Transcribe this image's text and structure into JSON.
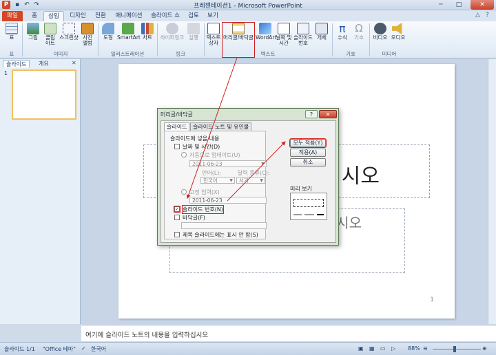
{
  "window": {
    "app_icon": "P",
    "title": "프레젠테이션1 - Microsoft PowerPoint",
    "minimize": "─",
    "maximize": "□",
    "close": "✕"
  },
  "tabs": [
    "파일",
    "홈",
    "삽입",
    "디자인",
    "전환",
    "애니메이션",
    "슬라이드 쇼",
    "검토",
    "보기"
  ],
  "active_tab": "삽입",
  "ribbon": {
    "table": "표",
    "picture": "그림",
    "clipart": "클립 아트",
    "screenshot": "스크린샷",
    "photo_album": "사진 앨범",
    "shapes": "도형",
    "smartart": "SmartArt",
    "chart": "차트",
    "hyperlink": "하이퍼링크",
    "action": "실행",
    "textbox": "텍스트 상자",
    "header_footer": "머리글/바닥글",
    "wordart": "WordArt",
    "date_time": "날짜 및 시간",
    "slide_number": "슬라이드 번호",
    "object": "개체",
    "equation": "수식",
    "symbol": "기호",
    "video": "비디오",
    "audio": "오디오",
    "groups": {
      "table": "표",
      "images": "이미지",
      "illustrations": "일러스트레이션",
      "links": "링크",
      "text": "텍스트",
      "symbols": "기호",
      "media": "미디어"
    }
  },
  "leftpane": {
    "tab_slides": "슬라이드",
    "tab_outline": "개요",
    "close": "✕",
    "slide_number": "1"
  },
  "slide": {
    "title_fragment": "시오",
    "subtitle_fragment": "시오",
    "page_number": "1"
  },
  "notes": {
    "placeholder": "여기에 슬라이드 노트의 내용을 입력하십시오"
  },
  "status": {
    "slide": "슬라이드 1/1",
    "theme": "\"Office 테마\"",
    "language": "한국어",
    "zoom": "88%"
  },
  "dialog": {
    "title": "머리글/바닥글",
    "help": "?",
    "close": "✕",
    "tabs": [
      "슬라이드",
      "슬라이드 노트 및 유인물"
    ],
    "section_label": "슬라이드에 넣을 내용",
    "date_time_label": "날짜 및 시간(D)",
    "auto_update_label": "자동으로 업데이트(U)",
    "auto_date_value": "2011-06-23",
    "language_label": "언어(L):",
    "calendar_label": "달력 종류(C):",
    "language_value": "한국어",
    "calendar_value": "서기",
    "fixed_label": "고정 입력(X)",
    "fixed_value": "2011-06-23",
    "slide_number_label": "슬라이드 번호(N)",
    "slide_number_checked": "✓",
    "footer_label": "바닥글(F)",
    "title_slide_label": "제목 슬라이드에는 표시 안 함(S)",
    "preview_label": "미리 보기",
    "apply_all": "모두 적용(Y)",
    "apply": "적용(A)",
    "cancel": "취소"
  }
}
